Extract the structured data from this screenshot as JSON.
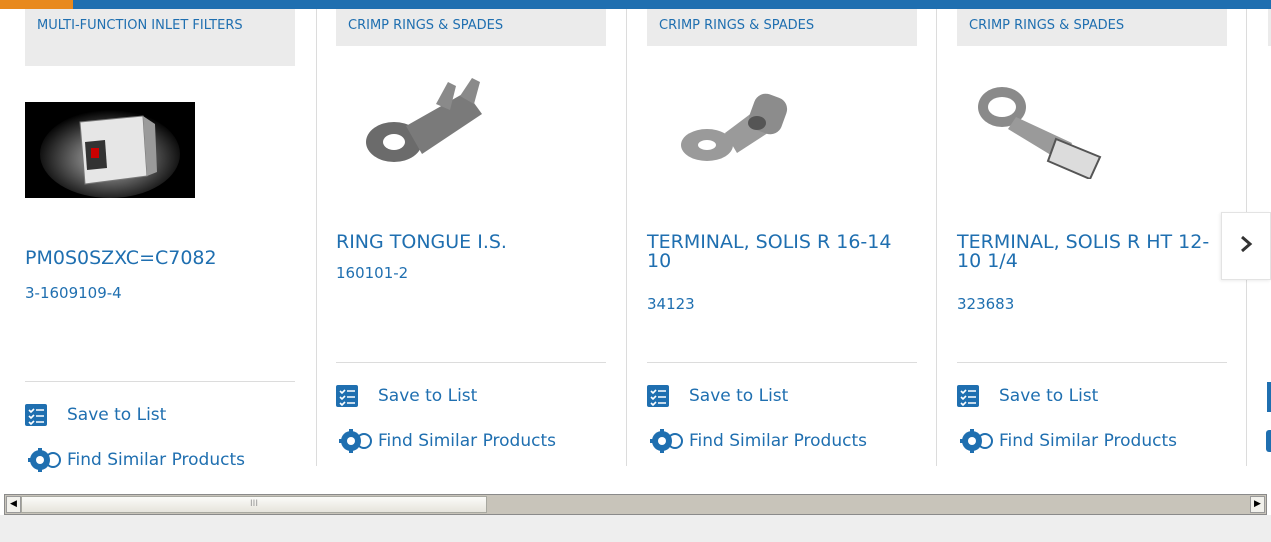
{
  "carousel": {
    "items": [
      {
        "category": "MULTI-FUNCTION INLET FILTERS",
        "title": "PM0S0SZXC=C7082",
        "part_number": "3-1609109-4",
        "image": "inlet-filter-photo"
      },
      {
        "category": "CRIMP RINGS & SPADES",
        "title": "RING TONGUE I.S.",
        "part_number": "160101-2",
        "image": "ring-tongue-photo"
      },
      {
        "category": "CRIMP RINGS & SPADES",
        "title": "TERMINAL, SOLIS R 16-14 10",
        "part_number": "34123",
        "image": "ring-terminal-photo"
      },
      {
        "category": "CRIMP RINGS & SPADES",
        "title": "TERMINAL, SOLIS R HT 12-10 1/4",
        "part_number": "323683",
        "image": "ring-terminal-ht-photo"
      }
    ],
    "save_label": "Save to List",
    "find_similar_label": "Find Similar Products",
    "next_icon": "chevron-right-icon"
  },
  "scrollbar": {
    "left_arrow": "◀",
    "right_arrow": "▶",
    "grip": "III"
  },
  "colors": {
    "brand_blue": "#1f6fb0",
    "accent_orange": "#e8891d"
  }
}
